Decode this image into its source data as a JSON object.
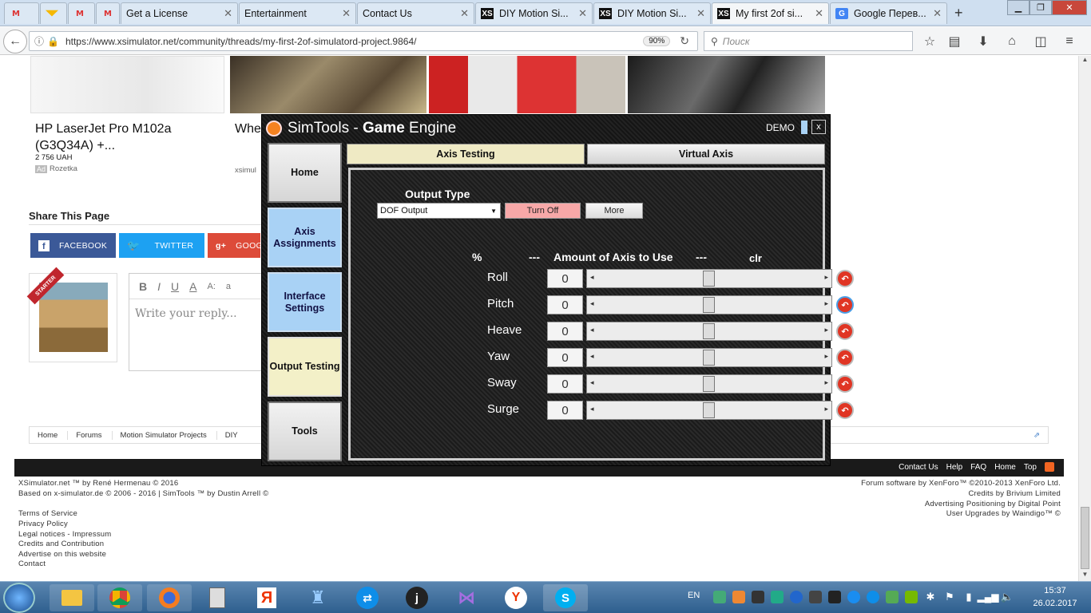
{
  "browser": {
    "tabs": [
      {
        "label": "",
        "icon": "gmail-icon"
      },
      {
        "label": "",
        "icon": "mail-icon"
      },
      {
        "label": "",
        "icon": "gmail-icon"
      },
      {
        "label": "",
        "icon": "gmail-icon"
      },
      {
        "label": "Get a License",
        "icon": "blank-icon"
      },
      {
        "label": "Entertainment",
        "icon": "blank-icon"
      },
      {
        "label": "Contact Us",
        "icon": "blank-icon"
      },
      {
        "label": "DIY Motion Si...",
        "icon": "xs-icon"
      },
      {
        "label": "DIY Motion Si...",
        "icon": "xs-icon"
      },
      {
        "label": "My first 2of si...",
        "icon": "xs-icon"
      },
      {
        "label": "Google Перев...",
        "icon": "google-translate-icon"
      }
    ],
    "url": "https://www.xsimulator.net/community/threads/my-first-2of-simulatord-project.9864/",
    "zoom": "90%",
    "search_placeholder": "Поиск"
  },
  "page": {
    "products": [
      {
        "title": "HP LaserJet Pro M102a (G3Q34A) +...",
        "price": "2 756 UAH",
        "ad_badge": "Ad",
        "vendor": "Rozetka"
      },
      {
        "title": "Whe",
        "vendor": "xsimul"
      }
    ],
    "share": {
      "heading": "Share This Page",
      "facebook": "FACEBOOK",
      "twitter": "TWITTER",
      "google": "GOOG"
    },
    "starter_badge": "STARTER",
    "reply_placeholder": "Write your reply...",
    "editor_tools": [
      "B",
      "I",
      "U",
      "A",
      "A:",
      "a"
    ],
    "breadcrumb": [
      "Home",
      "Forums",
      "Motion Simulator Projects",
      "DIY"
    ],
    "footer_bar": [
      "Contact Us",
      "Help",
      "FAQ",
      "Home",
      "Top"
    ],
    "footer_left": [
      "XSimulator.net ™ by René Hermenau © 2016",
      "Based on x-simulator.de © 2006 - 2016 | SimTools ™ by Dustin Arrell ©"
    ],
    "footer_links": [
      "Terms of Service",
      "Privacy Policy",
      "Legal notices - Impressum",
      "Credits and Contribution",
      "Advertise on this website",
      "Contact"
    ],
    "footer_right": [
      "Forum software by XenForo™ ©2010-2013 XenForo Ltd.",
      "Credits by Brivium Limited",
      "Advertising Positioning by Digital Point",
      "User Upgrades by Waindigo™ ©"
    ]
  },
  "simtools": {
    "title_a": "SimTools - ",
    "title_b": "Game",
    "title_c": " Engine",
    "demo": "DEMO",
    "close": "x",
    "nav": [
      "Home",
      "Axis Assignments",
      "Interface Settings",
      "Output Testing",
      "Tools"
    ],
    "top_tabs": [
      "Axis Testing",
      "Virtual Axis"
    ],
    "output_type_label": "Output Type",
    "output_type_value": "DOF Output",
    "turn_off": "Turn Off",
    "more": "More",
    "col_pct": "%",
    "col_dash1": "---",
    "col_amount": "Amount of Axis to Use",
    "col_dash2": "---",
    "col_clr": "clr",
    "axes": [
      {
        "name": "Roll",
        "value": "0"
      },
      {
        "name": "Pitch",
        "value": "0"
      },
      {
        "name": "Heave",
        "value": "0"
      },
      {
        "name": "Yaw",
        "value": "0"
      },
      {
        "name": "Sway",
        "value": "0"
      },
      {
        "name": "Surge",
        "value": "0"
      }
    ],
    "slider_position": 0.5
  },
  "taskbar": {
    "lang": "EN",
    "time": "15:37",
    "date": "26.02.2017"
  },
  "colors": {
    "facebook": "#3b5998",
    "twitter": "#1da1f2",
    "google": "#dd4b39",
    "sim_active_nav": "#f3f0c8",
    "sim_blue_nav": "#a9d2f5",
    "turn_off": "#f7a8a8"
  }
}
